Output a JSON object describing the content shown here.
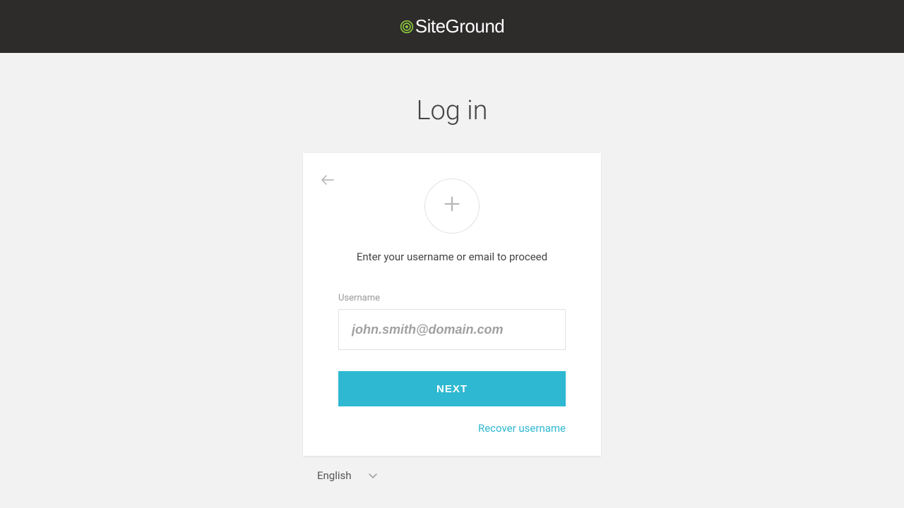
{
  "header": {
    "brand": "SiteGround"
  },
  "main": {
    "title": "Log in",
    "card": {
      "instruction": "Enter your username or email to proceed",
      "username": {
        "label": "Username",
        "placeholder": "john.smith@domain.com",
        "value": ""
      },
      "next_label": "NEXT",
      "recover_label": "Recover username"
    }
  },
  "footer": {
    "language": "English"
  },
  "colors": {
    "accent": "#2eb8d1",
    "header_bg": "#2e2b2b",
    "page_bg": "#f2f2f2"
  }
}
